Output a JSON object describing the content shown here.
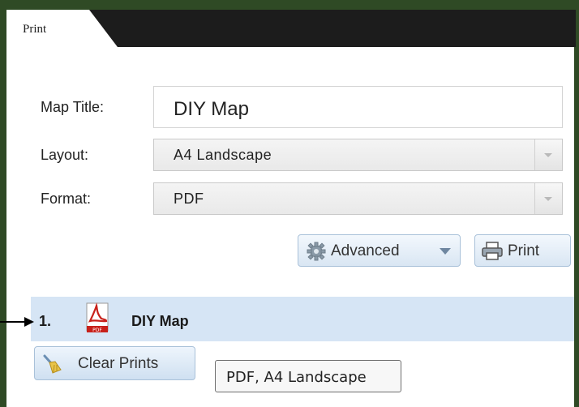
{
  "tab": {
    "label": "Print"
  },
  "form": {
    "title_label": "Map Title:",
    "title_value": "DIY Map",
    "layout_label": "Layout:",
    "layout_value": "A4 Landscape",
    "format_label": "Format:",
    "format_value": "PDF"
  },
  "buttons": {
    "advanced": "Advanced",
    "print": "Print",
    "clear_prints": "Clear Prints"
  },
  "prints": [
    {
      "number": "1.",
      "name": "DIY Map",
      "icon": "pdf-icon",
      "tooltip": "PDF, A4 Landscape"
    }
  ],
  "colors": {
    "frame": "#2f4a25",
    "tabbar": "#1c1c1c",
    "row_highlight": "#d6e5f5",
    "button_border": "#a9c1d9",
    "pdf_red": "#c8211b"
  }
}
